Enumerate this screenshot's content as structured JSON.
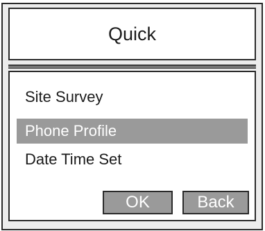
{
  "header": {
    "title": "Quick"
  },
  "menu": {
    "items": [
      {
        "label": "Site Survey",
        "selected": false
      },
      {
        "label": "Phone Profile",
        "selected": true
      },
      {
        "label": "Date Time Set",
        "selected": false
      }
    ]
  },
  "buttons": {
    "ok_label": "OK",
    "back_label": "Back"
  },
  "colors": {
    "selection": "#9a9a9a",
    "screen_background": "#ececec",
    "panel_background": "#ffffff",
    "border": "#2a2a2a"
  }
}
